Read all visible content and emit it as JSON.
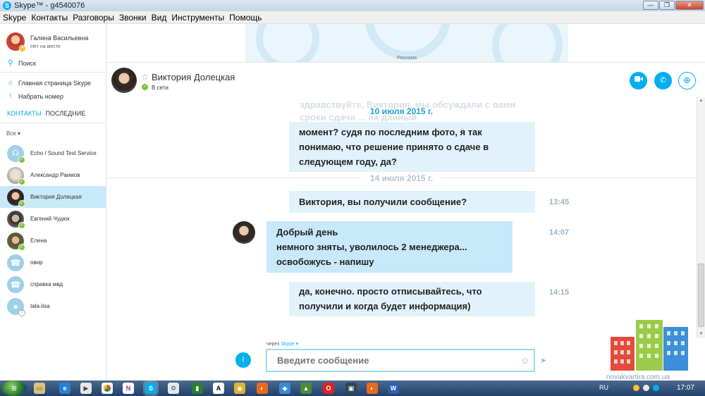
{
  "window": {
    "title": "Skype™ - g4540076",
    "app_icon": "skype-icon",
    "buttons": {
      "minimize": "—",
      "maximize": "❐",
      "close": "✕"
    }
  },
  "menu": [
    "Skype",
    "Контакты",
    "Разговоры",
    "Звонки",
    "Вид",
    "Инструменты",
    "Помощь"
  ],
  "profile": {
    "name": "Галина Васильевна",
    "status": "Нет на месте"
  },
  "sidebar": {
    "search": "Поиск",
    "home": "Главная страница Skype",
    "dial": "Набрать номер",
    "tabs": [
      "КОНТАКТЫ",
      "ПОСЛЕДНИЕ"
    ],
    "filter": "Все ▾",
    "contacts": [
      {
        "name": "Echo / Sound Test Service",
        "icon": "headset-icon",
        "status": "online"
      },
      {
        "name": "Александр Раимов",
        "icon": "avatar",
        "status": "online"
      },
      {
        "name": "Виктория Долецкая",
        "icon": "avatar",
        "status": "online",
        "selected": true
      },
      {
        "name": "Евгений Чудюк",
        "icon": "avatar",
        "status": "online"
      },
      {
        "name": "Елена",
        "icon": "avatar",
        "status": "online"
      },
      {
        "name": "овир",
        "icon": "phone-icon",
        "status": "none"
      },
      {
        "name": "справка мвд",
        "icon": "phone-icon",
        "status": "none"
      },
      {
        "name": "tala-lisa",
        "icon": "person-icon",
        "status": "offline"
      }
    ]
  },
  "ad": {
    "label": "Реклама"
  },
  "chat": {
    "name": "Виктория Долецкая",
    "status": "В сети",
    "faded_text": [
      "здравствуйте, Виктория, мы обсуждали с вами",
      "сроки сдачи ... на данный"
    ],
    "date1": "10 июля 2015 г.",
    "msg1_lines": [
      "момент? судя по последним фото, я так",
      "понимаю, что решение принято о сдаче в",
      "следующем году, да?"
    ],
    "date2": "14 июля 2015 г.",
    "msg2": "Виктория, вы получили сообщение?",
    "msg2_time": "13:45",
    "msg3_lines": [
      "Добрый день",
      "немного зняты, уволилось 2 менеджера...",
      "освобожусь - напишу"
    ],
    "msg3_time": "14:07",
    "msg4_lines": [
      "да, конечно. просто отписывайтесь, что",
      "получили и когда будет информация)"
    ],
    "msg4_time": "14:15"
  },
  "compose": {
    "via": "через",
    "via_brand": "Skype ▾",
    "placeholder": "Введите сообщение"
  },
  "watermark": {
    "text": "novakvartira.com.ua"
  },
  "taskbar": {
    "lang": "RU",
    "time": "17:07"
  },
  "colors": {
    "accent": "#00aff0",
    "bubble_in": "#c7e9fa",
    "bubble_out": "#e1f2fb",
    "online": "#7dc242",
    "away": "#f8c12d"
  }
}
